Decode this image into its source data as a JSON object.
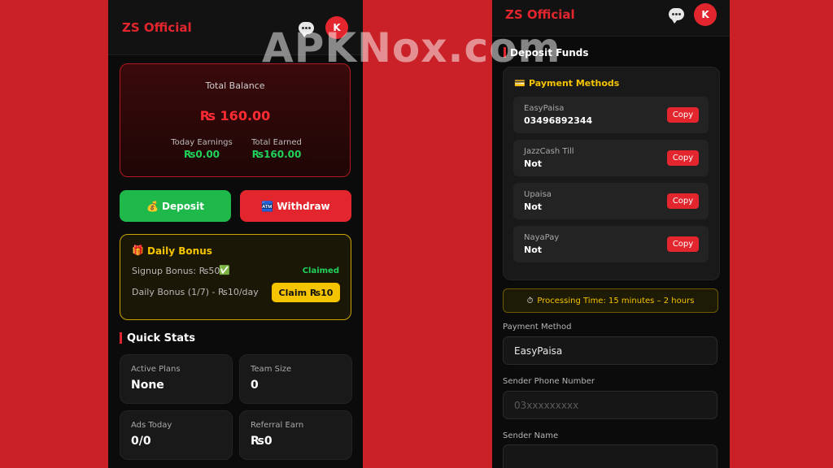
{
  "left": {
    "brand": "ZS Official",
    "avatar": "K",
    "balance": {
      "title": "Total Balance",
      "amount": "₨ 160.00",
      "today_label": "Today Earnings",
      "today_value": "₨0.00",
      "total_label": "Total Earned",
      "total_value": "₨160.00"
    },
    "deposit_icon": "💰",
    "deposit_label": "Deposit",
    "withdraw_icon": "🏧",
    "withdraw_label": "Withdraw",
    "bonus": {
      "icon": "🎁",
      "title": "Daily Bonus",
      "signup_text": "Signup Bonus: ₨50",
      "signup_check": "✅",
      "signup_status": "Claimed",
      "daily_text": "Daily Bonus (1/7) - ₨10/day",
      "claim_label": "Claim ₨10"
    },
    "stats_title": "Quick Stats",
    "stats": [
      {
        "label": "Active Plans",
        "value": "None"
      },
      {
        "label": "Team Size",
        "value": "0"
      },
      {
        "label": "Ads Today",
        "value": "0/0"
      },
      {
        "label": "Referral Earn",
        "value": "₨0"
      }
    ]
  },
  "right": {
    "brand": "ZS Official",
    "avatar": "K",
    "section_title": "Deposit Funds",
    "methods_icon": "💳",
    "methods_title": "Payment Methods",
    "copy_label": "Copy",
    "methods": [
      {
        "name": "EasyPaisa",
        "number": "03496892344"
      },
      {
        "name": "JazzCash Till",
        "number": "Not"
      },
      {
        "name": "Upaisa",
        "number": "Not"
      },
      {
        "name": "NayaPay",
        "number": "Not"
      }
    ],
    "processing_icon": "⏱",
    "processing_text": "Processing Time: 15 minutes – 2 hours",
    "payment_method_label": "Payment Method",
    "payment_method_value": "EasyPaisa",
    "sender_phone_label": "Sender Phone Number",
    "sender_phone_placeholder": "03xxxxxxxxx",
    "sender_name_label": "Sender Name"
  },
  "watermark": "APKNox.com",
  "colors": {
    "background": "#c92127",
    "accent_red": "#e3262d",
    "green": "#1fb84a",
    "yellow": "#f5c400"
  }
}
